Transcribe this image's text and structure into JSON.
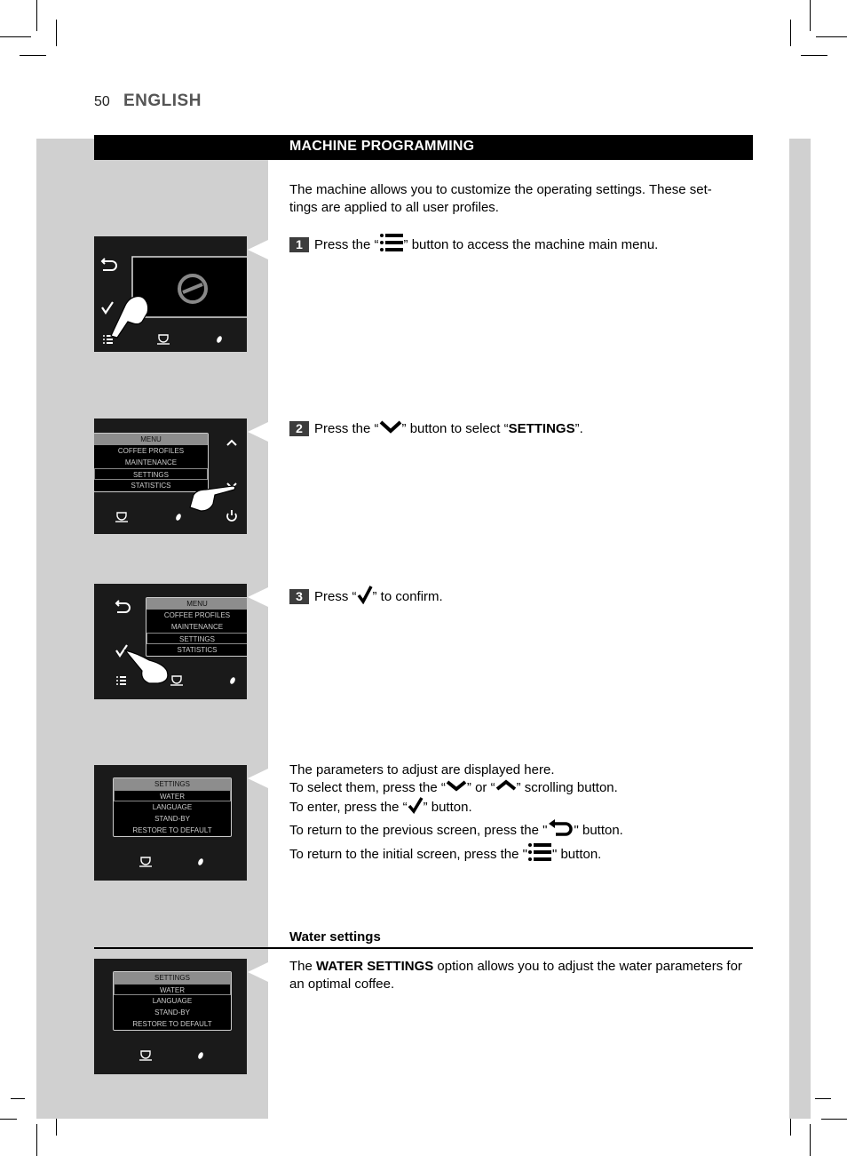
{
  "header": {
    "page_number": "50",
    "language": "ENGLISH"
  },
  "section": {
    "title": "MACHINE PROGRAMMING",
    "intro": "The machine allows you to customize the operating settings. These set-tings are applied to all user profiles."
  },
  "steps": [
    {
      "number": "1",
      "text_before": "Press the “",
      "icon": "menu-list-icon",
      "text_after": "” button to access the machine main menu."
    },
    {
      "number": "2",
      "text_before": "Press the “",
      "icon": "chevron-down-icon",
      "text_middle": "” button to select “",
      "bold": "SETTINGS",
      "text_after": "”."
    },
    {
      "number": "3",
      "text_before": "Press “",
      "icon": "check-icon",
      "text_after": "” to confirm."
    }
  ],
  "parameters_help": {
    "line1": "The parameters to adjust are displayed here.",
    "line2_a": "To select them, press the “",
    "line2_b": "” or “",
    "line2_c": "” scrolling button.",
    "line3_a": "To enter, press the “",
    "line3_b": "” button.",
    "line4_a": "To return to the previous screen, press the \"",
    "line4_b": "\" button.",
    "line5_a": "To return to the initial screen, press the \"",
    "line5_b": "\" button."
  },
  "water_settings": {
    "heading": "Water settings",
    "text_before": "The ",
    "bold": "WATER SETTINGS",
    "text_after": " option allows you to adjust the water parameters for an optimal coffee."
  },
  "screens": {
    "menu": {
      "header": "MENU",
      "items": [
        "COFFEE PROFILES",
        "MAINTENANCE",
        "SETTINGS",
        "STATISTICS"
      ],
      "selected": "SETTINGS"
    },
    "settings": {
      "header": "SETTINGS",
      "items": [
        "WATER",
        "LANGUAGE",
        "STAND-BY",
        "RESTORE TO DEFAULT"
      ],
      "selected": "WATER"
    }
  },
  "colors": {
    "section_bar": "#000000",
    "sidebar_gray": "#d0d0d0",
    "step_badge": "#3d3d3d",
    "screen_bg": "#1a1a1a"
  }
}
